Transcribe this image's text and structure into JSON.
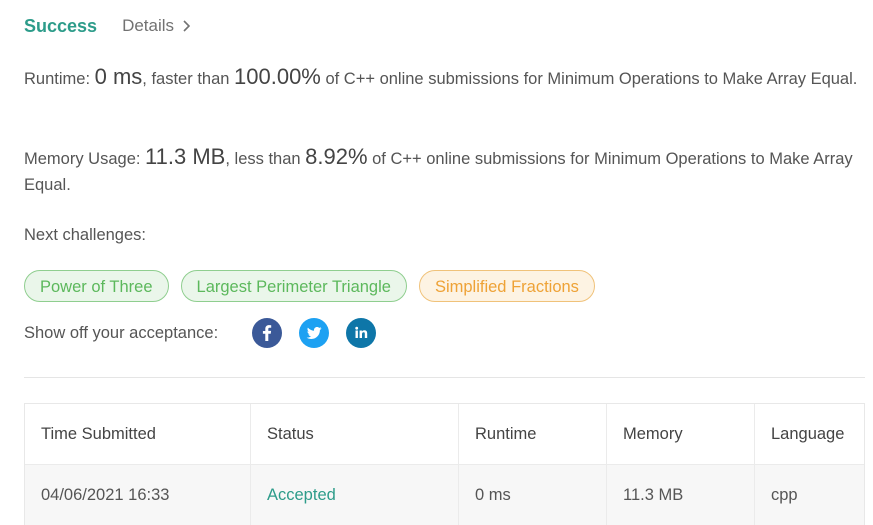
{
  "header": {
    "status": "Success",
    "details_label": "Details"
  },
  "runtime": {
    "label": "Runtime: ",
    "value": "0 ms",
    "comparison_text": ", faster than ",
    "percentile": "100.00%",
    "suffix": " of C++ online submissions for Minimum Operations to Make Array Equal."
  },
  "memory": {
    "label": "Memory Usage: ",
    "value": "11.3 MB",
    "comparison_text": ", less than ",
    "percentile": "8.92%",
    "suffix": " of C++ online submissions for Minimum Operations to Make Array Equal."
  },
  "next_challenges": {
    "label": "Next challenges:",
    "items": [
      {
        "title": "Power of Three",
        "difficulty_color": "#5cb85c"
      },
      {
        "title": "Largest Perimeter Triangle",
        "difficulty_color": "#5cb85c"
      },
      {
        "title": "Simplified Fractions",
        "difficulty_color": "#eea236"
      }
    ]
  },
  "share": {
    "label": "Show off your acceptance:",
    "networks": [
      {
        "icon": "facebook-icon",
        "color": "#3b5998"
      },
      {
        "icon": "twitter-icon",
        "color": "#1da1f2"
      },
      {
        "icon": "linkedin-icon",
        "color": "#0e76a8"
      }
    ]
  },
  "submissions_table": {
    "columns": [
      "Time Submitted",
      "Status",
      "Runtime",
      "Memory",
      "Language"
    ],
    "rows": [
      {
        "time_submitted": "04/06/2021 16:33",
        "status": "Accepted",
        "runtime": "0 ms",
        "memory": "11.3 MB",
        "language": "cpp"
      }
    ]
  },
  "colors": {
    "accent": "#2d9c8a",
    "easy": "#5cb85c",
    "medium": "#eea236"
  }
}
